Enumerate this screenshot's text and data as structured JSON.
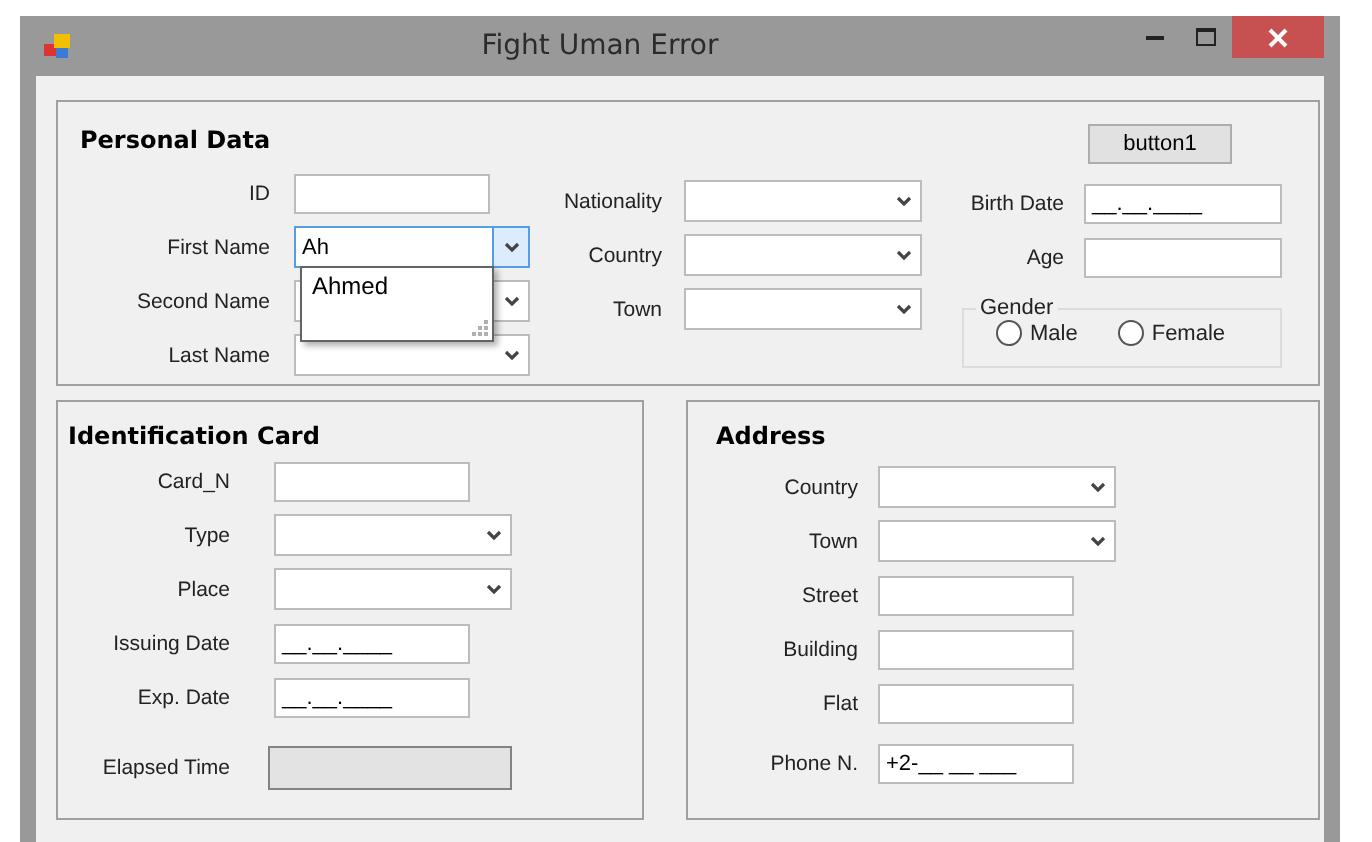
{
  "window": {
    "title": "Fight Uman Error"
  },
  "personal_data": {
    "title": "Personal Data",
    "button": "button1",
    "left_fields": [
      {
        "label": "ID",
        "kind": "text",
        "disabled": false
      },
      {
        "label": "First Name",
        "kind": "combo",
        "value": "Ah",
        "expanded": true,
        "dropdown_options": [
          "Ahmed"
        ]
      },
      {
        "label": "Second Name",
        "kind": "combo",
        "expanded": false
      },
      {
        "label": "Last Name",
        "kind": "combo",
        "expanded": false
      }
    ],
    "middle_fields": [
      {
        "label": "Nationality",
        "kind": "combo",
        "expanded": false
      },
      {
        "label": "Country",
        "kind": "combo",
        "expanded": false
      },
      {
        "label": "Town",
        "kind": "combo",
        "expanded": false
      }
    ],
    "right_fields": [
      {
        "label": "Birth Date",
        "kind": "text",
        "value": "__.__.____",
        "disabled": false
      },
      {
        "label": "Age",
        "kind": "text",
        "disabled": false
      }
    ],
    "gender": {
      "title": "Gender",
      "options": [
        {
          "label": "Male",
          "selected": false
        },
        {
          "label": "Female",
          "selected": false
        }
      ]
    }
  },
  "identification_card": {
    "title": "Identification Card",
    "fields": [
      {
        "label": "Card_N",
        "kind": "text",
        "disabled": false
      },
      {
        "label": "Type",
        "kind": "combo",
        "expanded": false
      },
      {
        "label": "Place",
        "kind": "combo",
        "expanded": false
      },
      {
        "label": "Issuing Date",
        "kind": "text",
        "value": "__.__.____",
        "disabled": false
      },
      {
        "label": "Exp. Date",
        "kind": "text",
        "value": "__.__.____",
        "disabled": false
      },
      {
        "label": "Elapsed Time",
        "kind": "text",
        "disabled": true
      }
    ]
  },
  "address": {
    "title": "Address",
    "fields": [
      {
        "label": "Country",
        "kind": "combo",
        "expanded": false
      },
      {
        "label": "Town",
        "kind": "combo",
        "expanded": false
      },
      {
        "label": "Street",
        "kind": "text",
        "disabled": false
      },
      {
        "label": "Building",
        "kind": "text",
        "disabled": false
      },
      {
        "label": "Flat",
        "kind": "text",
        "disabled": false
      },
      {
        "label": "Phone N.",
        "kind": "text",
        "value": "+2-__ __ ___",
        "disabled": false
      }
    ]
  }
}
